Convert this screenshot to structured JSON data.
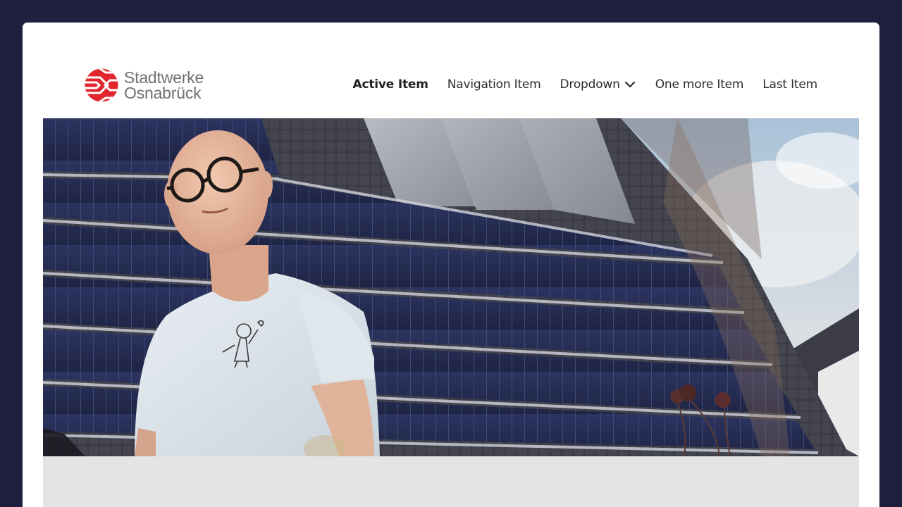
{
  "brand": {
    "line1": "Stadtwerke",
    "line2": "Osnabrück",
    "logo_icon": "stadtwerke-logo-icon",
    "accent_color": "#e2262d"
  },
  "nav": {
    "items": [
      {
        "label": "Active Item",
        "active": true
      },
      {
        "label": "Navigation Item",
        "active": false
      },
      {
        "label": "Dropdown",
        "active": false,
        "icon": "chevron-down-icon"
      },
      {
        "label": "One more Item",
        "active": false
      },
      {
        "label": "Last Item",
        "active": false
      }
    ]
  },
  "hero": {
    "image": "man-in-front-of-solar-roof-photo"
  },
  "colors": {
    "page_background": "#1f1f3f",
    "card_background": "#ffffff",
    "footer_band": "#e4e4e4"
  }
}
